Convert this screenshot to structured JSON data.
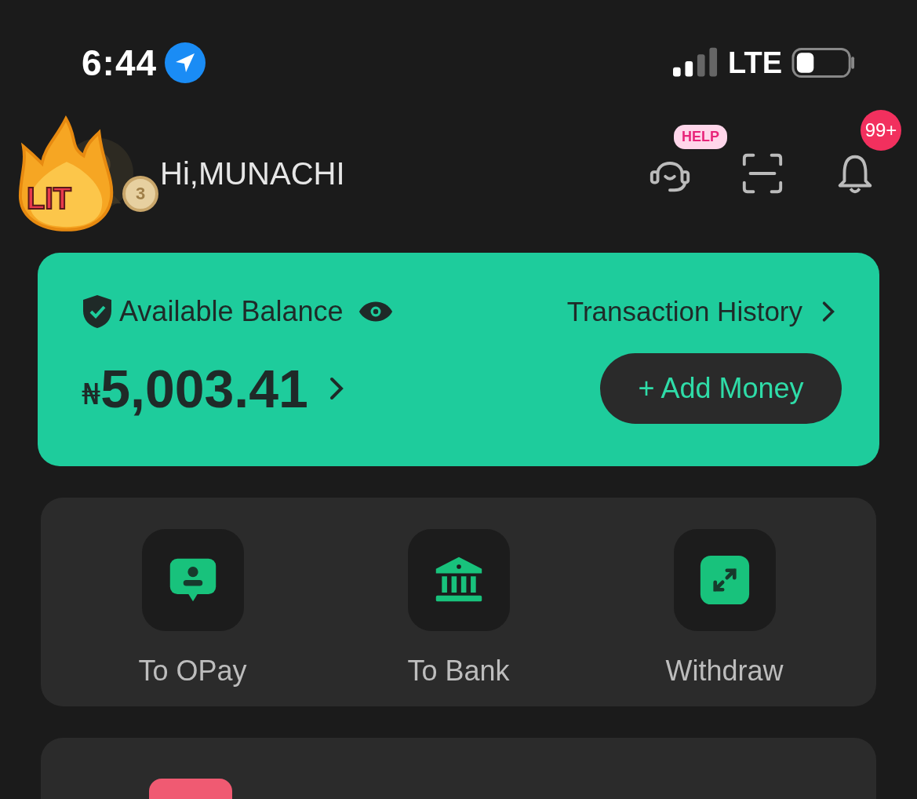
{
  "status_bar": {
    "time": "6:44",
    "network": "LTE"
  },
  "header": {
    "sticker_text": "LIT",
    "medal_text": "3",
    "greeting": "Hi,MUNACHI",
    "help_badge": "HELP",
    "notification_count": "99+"
  },
  "balance_card": {
    "label": "Available Balance",
    "history_link": "Transaction History",
    "currency": "₦",
    "amount": "5,003.41",
    "add_money": "+ Add Money"
  },
  "actions": [
    {
      "label": "To OPay",
      "kind": "opay"
    },
    {
      "label": "To Bank",
      "kind": "bank"
    },
    {
      "label": "Withdraw",
      "kind": "withdraw"
    }
  ]
}
